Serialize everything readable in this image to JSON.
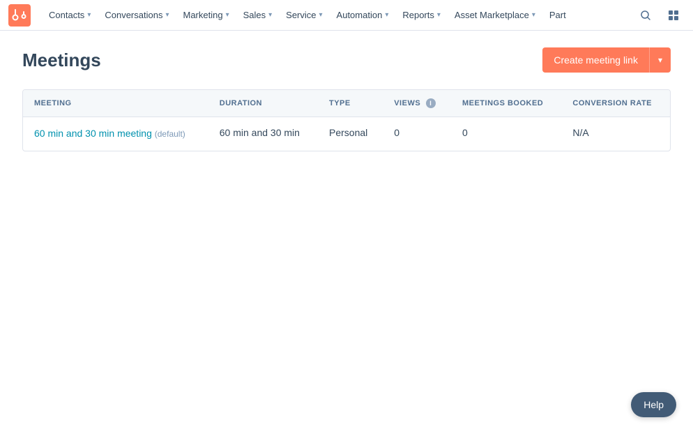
{
  "navbar": {
    "logo_color": "#ff7a59",
    "items": [
      {
        "label": "Contacts",
        "has_chevron": true
      },
      {
        "label": "Conversations",
        "has_chevron": true
      },
      {
        "label": "Marketing",
        "has_chevron": true
      },
      {
        "label": "Sales",
        "has_chevron": true
      },
      {
        "label": "Service",
        "has_chevron": true
      },
      {
        "label": "Automation",
        "has_chevron": true
      },
      {
        "label": "Reports",
        "has_chevron": true
      },
      {
        "label": "Asset Marketplace",
        "has_chevron": true
      },
      {
        "label": "Part",
        "has_chevron": false
      }
    ]
  },
  "page": {
    "title": "Meetings"
  },
  "create_button": {
    "label": "Create meeting link",
    "arrow": "▾"
  },
  "table": {
    "columns": [
      {
        "key": "meeting",
        "label": "MEETING",
        "has_info": false
      },
      {
        "key": "duration",
        "label": "DURATION",
        "has_info": false
      },
      {
        "key": "type",
        "label": "TYPE",
        "has_info": false
      },
      {
        "key": "views",
        "label": "VIEWS",
        "has_info": true
      },
      {
        "key": "meetings_booked",
        "label": "MEETINGS BOOKED",
        "has_info": false
      },
      {
        "key": "conversion_rate",
        "label": "CONVERSION RATE",
        "has_info": false
      }
    ],
    "rows": [
      {
        "meeting_name": "60 min and 30 min meeting",
        "meeting_default": "(default)",
        "duration": "60 min and 30 min",
        "type": "Personal",
        "views": "0",
        "meetings_booked": "0",
        "conversion_rate": "N/A"
      }
    ]
  },
  "help_button": {
    "label": "Help"
  }
}
